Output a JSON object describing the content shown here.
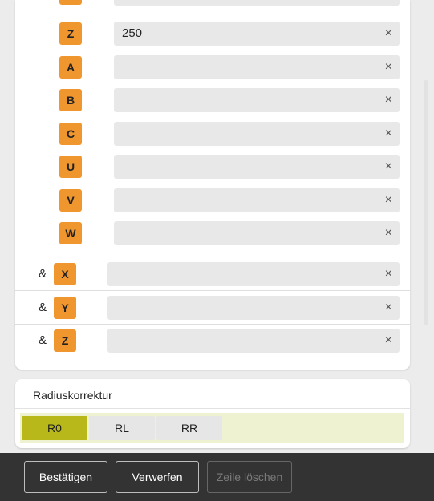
{
  "axes_single": [
    {
      "letter": "Z",
      "value": "250"
    },
    {
      "letter": "A",
      "value": ""
    },
    {
      "letter": "B",
      "value": ""
    },
    {
      "letter": "C",
      "value": ""
    },
    {
      "letter": "U",
      "value": ""
    },
    {
      "letter": "V",
      "value": ""
    },
    {
      "letter": "W",
      "value": ""
    }
  ],
  "axes_and": [
    {
      "prefix": "&",
      "letter": "X",
      "value": ""
    },
    {
      "prefix": "&",
      "letter": "Y",
      "value": ""
    },
    {
      "prefix": "&",
      "letter": "Z",
      "value": ""
    }
  ],
  "clear_glyph": "×",
  "radius": {
    "title": "Radiuskorrektur",
    "options": [
      "R0",
      "RL",
      "RR"
    ],
    "selected": "R0"
  },
  "footer": {
    "confirm": "Bestätigen",
    "discard": "Verwerfen",
    "delete_line": "Zeile löschen"
  },
  "colors": {
    "badge": "#f0962f",
    "selected_segment": "#b8b81a",
    "segment_bar": "#eff2d0",
    "footer_bg": "#333333"
  }
}
